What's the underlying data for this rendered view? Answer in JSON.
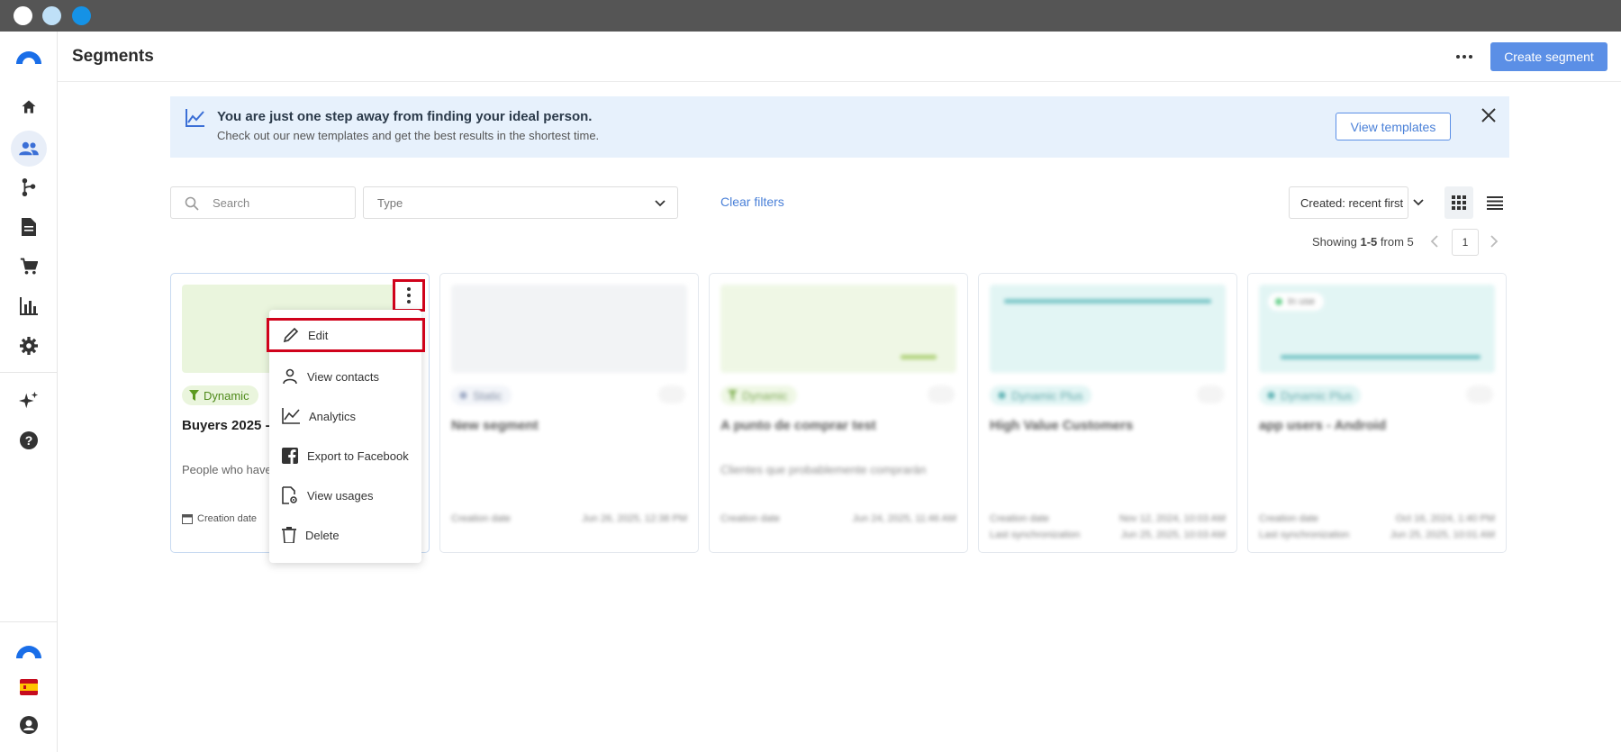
{
  "app": {
    "page_title": "Segments",
    "create_button": "Create segment"
  },
  "banner": {
    "title": "You are just one step away from finding your ideal person.",
    "subtitle": "Check out our new templates and get the best results in the shortest time.",
    "button": "View templates"
  },
  "filters": {
    "search_placeholder": "Search",
    "type_placeholder": "Type",
    "clear_label": "Clear filters",
    "sort_label": "Created: recent first"
  },
  "pagination": {
    "showing_prefix": "Showing ",
    "showing_range": "1-5",
    "showing_suffix": " from 5",
    "page": "1"
  },
  "cards": [
    {
      "tag": "Dynamic",
      "name": "Buyers 2025 - ",
      "desc": "People who have",
      "meta1": "Creation date",
      "date1": ""
    },
    {
      "tag": "Static",
      "name": "New segment",
      "desc": "",
      "meta1": "Creation date",
      "date1": "Jun 26, 2025, 12:38 PM"
    },
    {
      "tag": "Dynamic",
      "name": "A punto de comprar test",
      "desc": "Clientes que probablemente comprarán",
      "meta1": "Creation date",
      "date1": "Jun 24, 2025, 11:46 AM"
    },
    {
      "tag": "Dynamic Plus",
      "name": "High Value Customers",
      "desc": "",
      "meta1": "Creation date",
      "date1": "Nov 12, 2024, 10:03 AM",
      "meta2": "Last synchronization",
      "date2": "Jun 25, 2025, 10:03 AM"
    },
    {
      "tag": "Dynamic Plus",
      "name": "app users - Android",
      "desc": "",
      "meta1": "Creation date",
      "date1": "Oct 16, 2024, 1:40 PM",
      "meta2": "Last synchronization",
      "date2": "Jun 25, 2025, 10:01 AM",
      "badge": "In use"
    }
  ],
  "menu": {
    "edit": "Edit",
    "view_contacts": "View contacts",
    "analytics": "Analytics",
    "export_facebook": "Export to Facebook",
    "view_usages": "View usages",
    "delete": "Delete"
  },
  "colors": {
    "accent": "#5b8fe6",
    "highlight": "#d0021b",
    "banner_bg": "#e7f1fc",
    "dynamic_tag_bg": "#eaf5dd",
    "dynamic_plus_tag_bg": "#d9f2f1"
  }
}
